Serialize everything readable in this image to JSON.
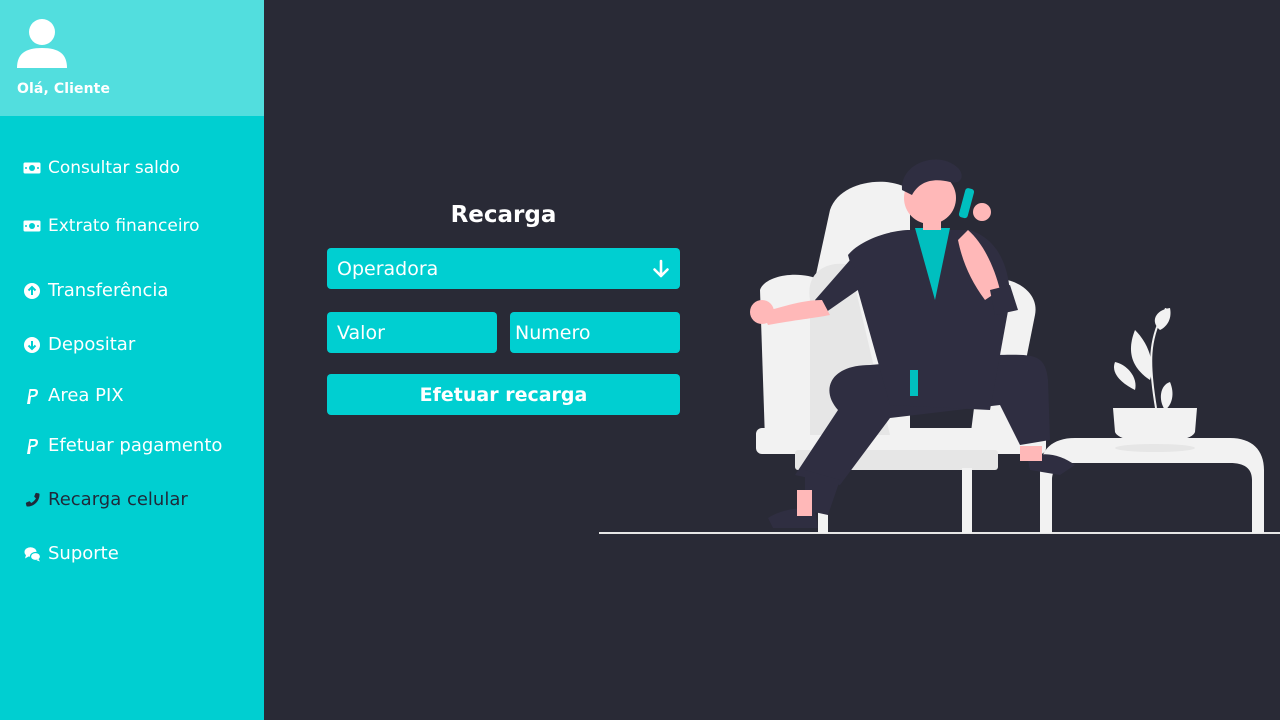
{
  "profile": {
    "greeting": "Olá, Cliente",
    "icon": "user-icon"
  },
  "sidebar": {
    "items": [
      {
        "label": "Consultar saldo",
        "icon": "money-bill-icon"
      },
      {
        "label": "Extrato financeiro",
        "icon": "money-bill-icon"
      },
      {
        "label": "Transferência",
        "icon": "arrow-up-circle-icon"
      },
      {
        "label": "Depositar",
        "icon": "arrow-down-circle-icon"
      },
      {
        "label": "Area PIX",
        "icon": "paypal-icon"
      },
      {
        "label": "Efetuar pagamento",
        "icon": "paypal-icon"
      },
      {
        "label": "Recarga celular",
        "icon": "phone-icon"
      },
      {
        "label": "Suporte",
        "icon": "chat-icon"
      }
    ]
  },
  "form": {
    "title": "Recarga",
    "operadora": {
      "placeholder": "Operadora"
    },
    "valor": {
      "placeholder": "Valor"
    },
    "numero": {
      "placeholder": "Numero"
    },
    "submit_label": "Efetuar recarga"
  },
  "colors": {
    "accent": "#00cfd1",
    "profile_bg": "#52dede",
    "background": "#292a36",
    "active_text": "#1f2a3a"
  }
}
